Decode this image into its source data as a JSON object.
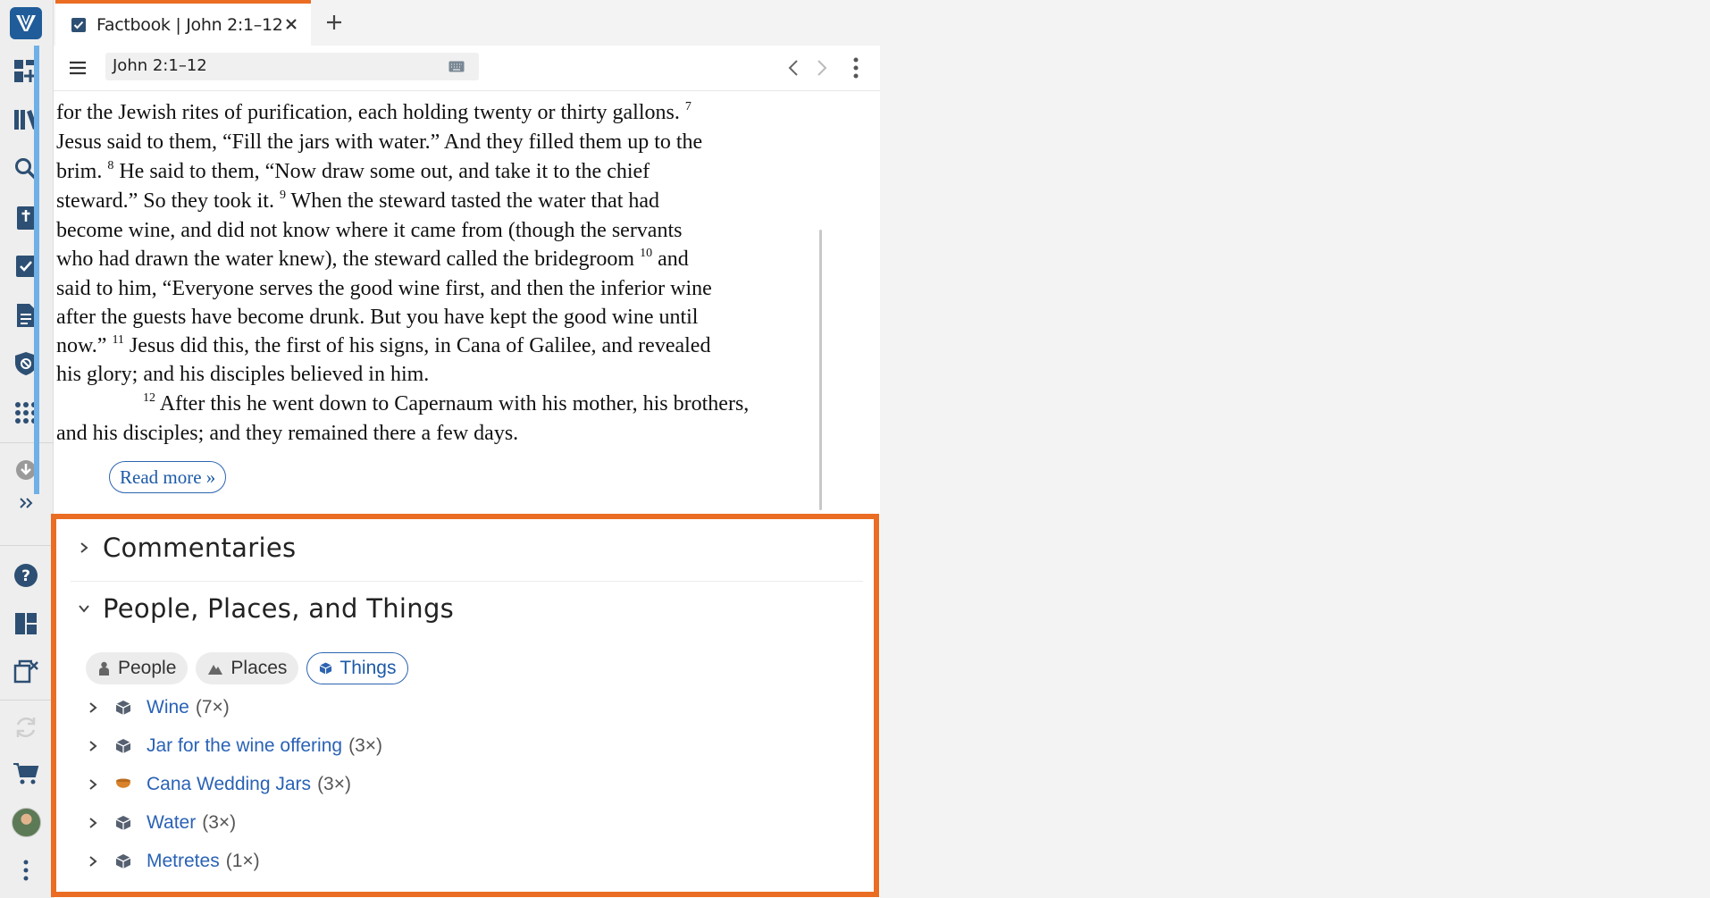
{
  "tab": {
    "title": "Factbook | John 2:1–12"
  },
  "toolbar": {
    "reference": "John 2:1–12"
  },
  "scripture": {
    "lines": [
      "for the Jewish rites of purification, each holding twenty or thirty gallons.",
      "Jesus said to them, “Fill the jars with water.” And they filled them up to the",
      "brim.",
      "He said to them, “Now draw some out, and take it to the chief",
      "steward.” So they took it.",
      "When the steward tasted the water that had",
      "become wine, and did not know where it came from (though the servants",
      "who had drawn the water knew), the steward called the bridegroom",
      "and",
      "said to him, “Everyone serves the good wine first, and then the inferior wine",
      "after the guests have become drunk. But you have kept the good wine until",
      "now.”",
      "Jesus did this, the first of his signs, in Cana of Galilee, and revealed",
      "his glory; and his disciples believed in him.",
      "After this he went down to Capernaum with his mother, his brothers,",
      "and his disciples; and they remained there a few days."
    ],
    "verse_numbers": {
      "v7": "7",
      "v8": "8",
      "v9": "9",
      "v10": "10",
      "v11": "11",
      "v12": "12"
    },
    "read_more": "Read more »"
  },
  "sections": {
    "commentaries": "Commentaries",
    "ppt": "People, Places, and Things"
  },
  "chips": [
    {
      "label": "People",
      "icon": "person-icon",
      "active": false
    },
    {
      "label": "Places",
      "icon": "mountain-icon",
      "active": false
    },
    {
      "label": "Things",
      "icon": "cube-icon",
      "active": true
    }
  ],
  "things": [
    {
      "label": "Wine",
      "count": "(7×)",
      "icon": "cube-icon"
    },
    {
      "label": "Jar for the wine offering",
      "count": "(3×)",
      "icon": "cube-icon"
    },
    {
      "label": "Cana Wedding Jars",
      "count": "(3×)",
      "icon": "pot-icon"
    },
    {
      "label": "Water",
      "count": "(3×)",
      "icon": "cube-icon"
    },
    {
      "label": "Metretes",
      "count": "(1×)",
      "icon": "cube-icon"
    }
  ],
  "colors": {
    "accent": "#ea6d23",
    "link": "#2a62b5",
    "quote_bar": "#6fb0e6"
  }
}
